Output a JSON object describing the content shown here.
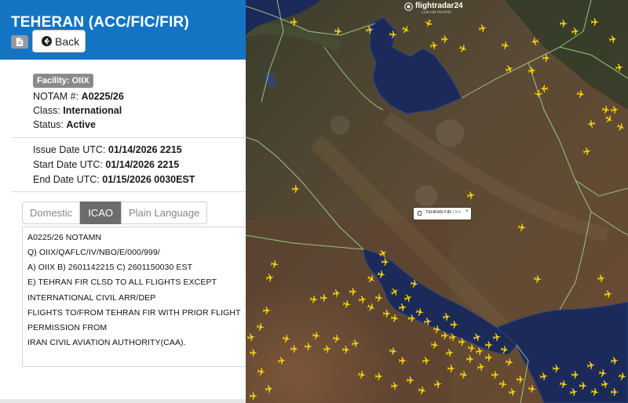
{
  "header": {
    "title": "TEHERAN (ACC/FIC/FIR)",
    "back_label": "Back",
    "icons": [
      "pdf-icon",
      "back-arrow-icon"
    ]
  },
  "notam": {
    "facility_badge": "Facility:  OIIX",
    "number_label": "NOTAM #:",
    "number": "A0225/26",
    "class_label": "Class:",
    "class": "International",
    "status_label": "Status:",
    "status": "Active",
    "issue_label": "Issue Date UTC:",
    "issue": "01/14/2026 2215",
    "start_label": "Start Date UTC:",
    "start": "01/14/2026 2215",
    "end_label": "End Date UTC:",
    "end": "01/15/2026 0030EST"
  },
  "tabs": [
    {
      "label": "Domestic",
      "active": false
    },
    {
      "label": "ICAO",
      "active": true
    },
    {
      "label": "Plain Language",
      "active": false
    }
  ],
  "icao_text": [
    "A0225/26 NOTAMN",
    "Q) OIIX/QAFLC/IV/NBO/E/000/999/",
    "A) OIIX B) 2601142215 C) 2601150030 EST",
    "E) TEHRAN FIR CLSD TO ALL FLIGHTS EXCEPT",
    "INTERNATIONAL CIVIL ARR/DEP",
    "FLIGHTS TO/FROM TEHRAN FIR WITH PRIOR FLIGHT",
    "PERMISSION FROM",
    "IRAN CIVIL AVIATION AUTHORITY(CAA)."
  ],
  "map": {
    "brand_name": "flightradar24",
    "brand_tag": "LIVE AIR TRAFFIC",
    "fir_label": "TEHRAN FIR",
    "fir_code": "OIIX",
    "fir_close": "×",
    "aircraft_color": "#f5d20f",
    "boundary_color": "#9fd38a"
  }
}
